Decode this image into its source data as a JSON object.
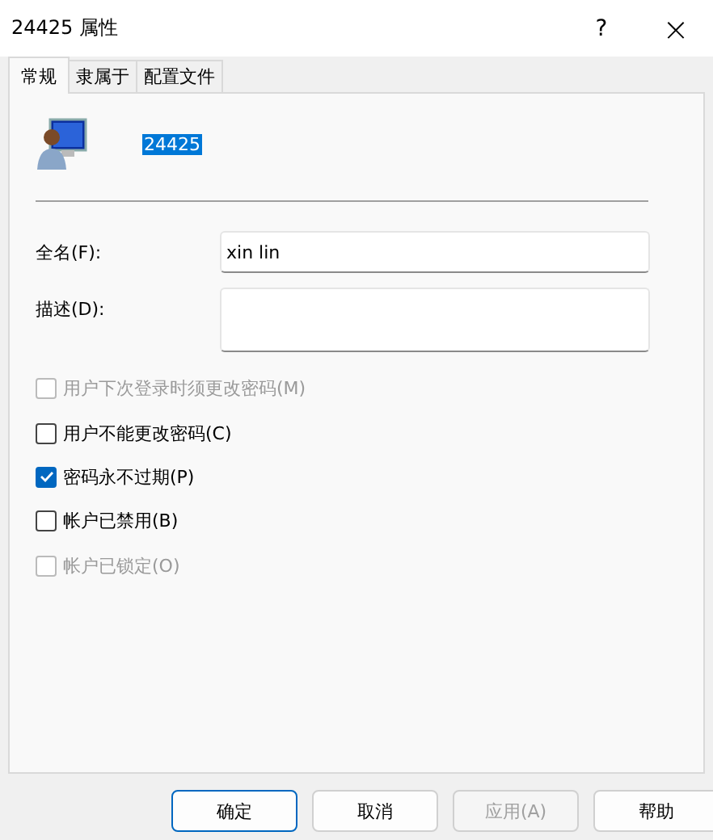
{
  "window": {
    "title": "24425 属性",
    "help": "?",
    "close": "×"
  },
  "tabs": [
    {
      "label": "常规",
      "selected": true
    },
    {
      "label": "隶属于",
      "selected": false
    },
    {
      "label": "配置文件",
      "selected": false
    }
  ],
  "user": {
    "name": "24425",
    "selected": true
  },
  "fields": [
    {
      "label": "全名(F):",
      "value": "xin lin",
      "kind": "line"
    },
    {
      "label": "描述(D):",
      "kind": "area"
    }
  ],
  "options": [
    {
      "label": "用户下次登录时须更改密码(M)",
      "checked": false,
      "disabled": true
    },
    {
      "label": "用户不能更改密码(C)",
      "checked": false,
      "disabled": false
    },
    {
      "label": "密码永不过期(P)",
      "checked": true,
      "disabled": false
    },
    {
      "label": "帐户已禁用(B)",
      "checked": false,
      "disabled": false
    },
    {
      "label": "帐户已锁定(O)",
      "checked": false,
      "disabled": true
    }
  ],
  "buttons": [
    {
      "label": "确定",
      "default": true,
      "disabled": false
    },
    {
      "label": "取消",
      "default": false,
      "disabled": false
    },
    {
      "label": "应用(A)",
      "default": false,
      "disabled": true
    },
    {
      "label": "帮助",
      "default": false,
      "disabled": false
    }
  ]
}
